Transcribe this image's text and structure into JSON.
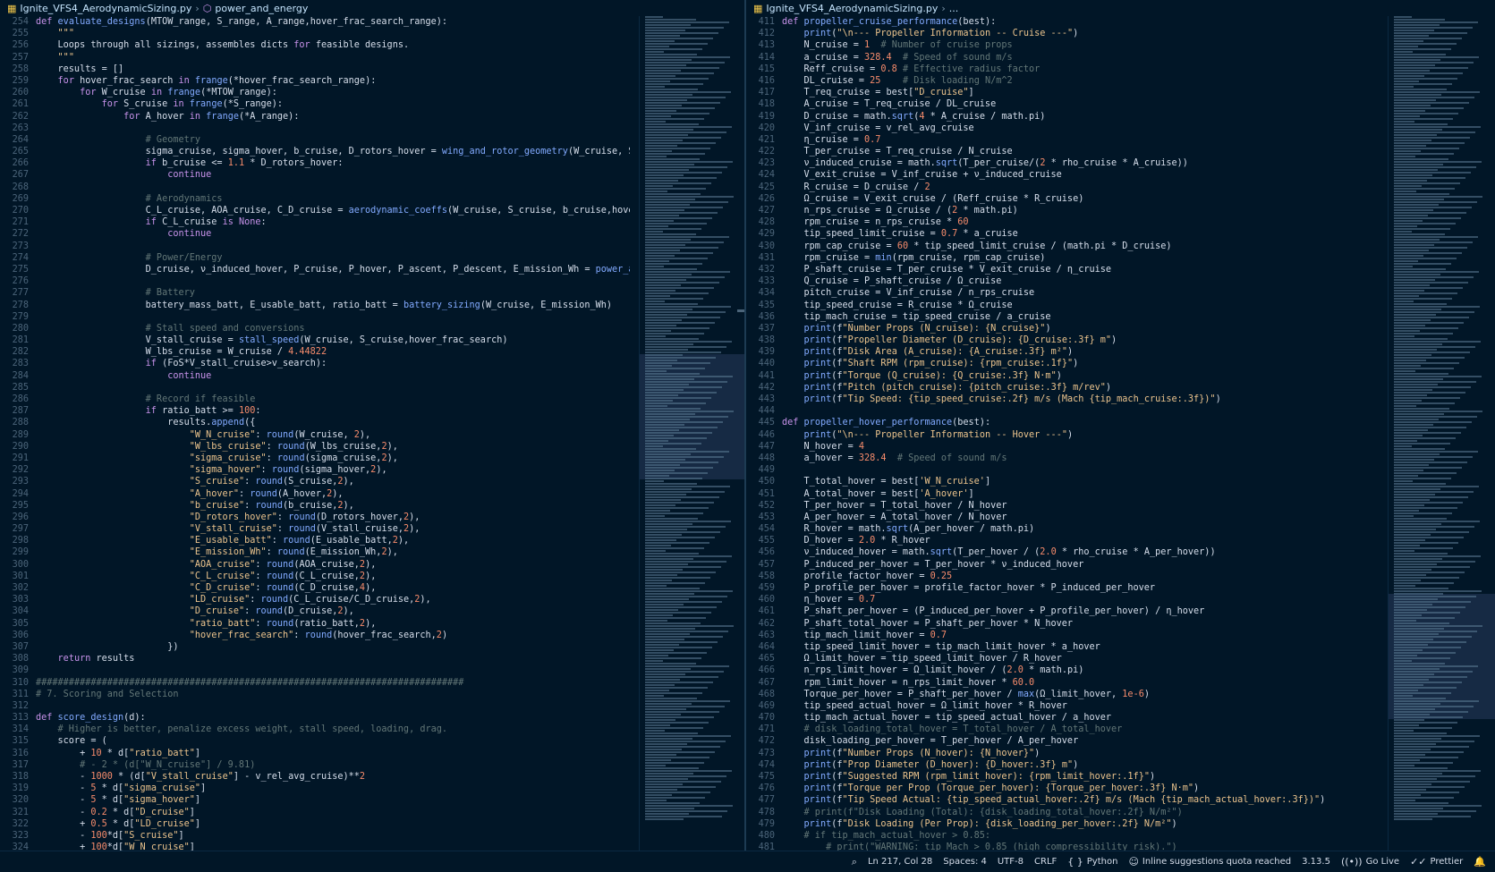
{
  "left_editor": {
    "breadcrumb": {
      "file": "Ignite_VFS4_AerodynamicSizing.py",
      "symbol": "power_and_energy"
    },
    "lines": [
      {
        "n": "254",
        "t": "def evaluate_designs(MTOW_range, S_range, A_range,hover_frac_search_range):"
      },
      {
        "n": "255",
        "t": "    \"\"\""
      },
      {
        "n": "256",
        "t": "    Loops through all sizings, assembles dicts for feasible designs."
      },
      {
        "n": "257",
        "t": "    \"\"\""
      },
      {
        "n": "258",
        "t": "    results = []"
      },
      {
        "n": "259",
        "t": "    for hover_frac_search in frange(*hover_frac_search_range):"
      },
      {
        "n": "260",
        "t": "        for W_cruise in frange(*MTOW_range):"
      },
      {
        "n": "261",
        "t": "            for S_cruise in frange(*S_range):"
      },
      {
        "n": "262",
        "t": "                for A_hover in frange(*A_range):"
      },
      {
        "n": "263",
        "t": ""
      },
      {
        "n": "264",
        "t": "                    # Geometry"
      },
      {
        "n": "265",
        "t": "                    sigma_cruise, sigma_hover, b_cruise, D_rotors_hover = wing_and_rotor_geometry(W_cruise, S_cruise, A_hove"
      },
      {
        "n": "266",
        "t": "                    if b_cruise <= 1.1 * D_rotors_hover:"
      },
      {
        "n": "267",
        "t": "                        continue"
      },
      {
        "n": "268",
        "t": ""
      },
      {
        "n": "269",
        "t": "                    # Aerodynamics"
      },
      {
        "n": "270",
        "t": "                    C_L_cruise, AOA_cruise, C_D_cruise = aerodynamic_coeffs(W_cruise, S_cruise, b_cruise,hover_frac_search)"
      },
      {
        "n": "271",
        "t": "                    if C_L_cruise is None:"
      },
      {
        "n": "272",
        "t": "                        continue"
      },
      {
        "n": "273",
        "t": ""
      },
      {
        "n": "274",
        "t": "                    # Power/Energy"
      },
      {
        "n": "275",
        "t": "                    D_cruise, ν_induced_hover, P_cruise, P_hover, P_ascent, P_descent, E_mission_Wh = power_and_energy(W_cru"
      },
      {
        "n": "276",
        "t": ""
      },
      {
        "n": "277",
        "t": "                    # Battery"
      },
      {
        "n": "278",
        "t": "                    battery_mass_batt, E_usable_batt, ratio_batt = battery_sizing(W_cruise, E_mission_Wh)"
      },
      {
        "n": "279",
        "t": ""
      },
      {
        "n": "280",
        "t": "                    # Stall speed and conversions"
      },
      {
        "n": "281",
        "t": "                    V_stall_cruise = stall_speed(W_cruise, S_cruise,hover_frac_search)"
      },
      {
        "n": "282",
        "t": "                    W_lbs_cruise = W_cruise / 4.44822"
      },
      {
        "n": "283",
        "t": "                    if (FoS*V_stall_cruise>v_search):"
      },
      {
        "n": "284",
        "t": "                        continue"
      },
      {
        "n": "285",
        "t": ""
      },
      {
        "n": "286",
        "t": "                    # Record if feasible"
      },
      {
        "n": "287",
        "t": "                    if ratio_batt >= 100:"
      },
      {
        "n": "288",
        "t": "                        results.append({"
      },
      {
        "n": "289",
        "t": "                            \"W_N_cruise\": round(W_cruise, 2),"
      },
      {
        "n": "290",
        "t": "                            \"W_lbs_cruise\": round(W_lbs_cruise,2),"
      },
      {
        "n": "291",
        "t": "                            \"sigma_cruise\": round(sigma_cruise,2),"
      },
      {
        "n": "292",
        "t": "                            \"sigma_hover\": round(sigma_hover,2),"
      },
      {
        "n": "293",
        "t": "                            \"S_cruise\": round(S_cruise,2),"
      },
      {
        "n": "294",
        "t": "                            \"A_hover\": round(A_hover,2),"
      },
      {
        "n": "295",
        "t": "                            \"b_cruise\": round(b_cruise,2),"
      },
      {
        "n": "296",
        "t": "                            \"D_rotors_hover\": round(D_rotors_hover,2),"
      },
      {
        "n": "297",
        "t": "                            \"V_stall_cruise\": round(V_stall_cruise,2),"
      },
      {
        "n": "298",
        "t": "                            \"E_usable_batt\": round(E_usable_batt,2),"
      },
      {
        "n": "299",
        "t": "                            \"E_mission_Wh\": round(E_mission_Wh,2),"
      },
      {
        "n": "300",
        "t": "                            \"AOA_cruise\": round(AOA_cruise,2),"
      },
      {
        "n": "301",
        "t": "                            \"C_L_cruise\": round(C_L_cruise,2),"
      },
      {
        "n": "302",
        "t": "                            \"C_D_cruise\": round(C_D_cruise,4),"
      },
      {
        "n": "303",
        "t": "                            \"LD_cruise\": round(C_L_cruise/C_D_cruise,2),"
      },
      {
        "n": "304",
        "t": "                            \"D_cruise\": round(D_cruise,2),"
      },
      {
        "n": "305",
        "t": "                            \"ratio_batt\": round(ratio_batt,2),"
      },
      {
        "n": "306",
        "t": "                            \"hover_frac_search\": round(hover_frac_search,2)"
      },
      {
        "n": "307",
        "t": "                        })"
      },
      {
        "n": "308",
        "t": "    return results"
      },
      {
        "n": "309",
        "t": ""
      },
      {
        "n": "310",
        "t": "##############################################################################"
      },
      {
        "n": "311",
        "t": "# 7. Scoring and Selection"
      },
      {
        "n": "312",
        "t": ""
      },
      {
        "n": "313",
        "t": "def score_design(d):"
      },
      {
        "n": "314",
        "t": "    # Higher is better, penalize excess weight, stall speed, loading, drag."
      },
      {
        "n": "315",
        "t": "    score = ("
      },
      {
        "n": "316",
        "t": "        + 10 * d[\"ratio_batt\"]"
      },
      {
        "n": "317",
        "t": "        # - 2 * (d[\"W_N_cruise\"] / 9.81)"
      },
      {
        "n": "318",
        "t": "        - 1000 * (d[\"V_stall_cruise\"] - v_rel_avg_cruise)**2"
      },
      {
        "n": "319",
        "t": "        - 5 * d[\"sigma_cruise\"]"
      },
      {
        "n": "320",
        "t": "        - 5 * d[\"sigma_hover\"]"
      },
      {
        "n": "321",
        "t": "        - 0.2 * d[\"D_cruise\"]"
      },
      {
        "n": "322",
        "t": "        + 0.5 * d[\"LD_cruise\"]"
      },
      {
        "n": "323",
        "t": "        - 100*d[\"S_cruise\"]"
      },
      {
        "n": "324",
        "t": "        + 100*d[\"W_N_cruise\"]"
      }
    ]
  },
  "right_editor": {
    "breadcrumb": {
      "file": "Ignite_VFS4_AerodynamicSizing.py",
      "symbol": "..."
    },
    "lines": [
      {
        "n": "411",
        "t": "def propeller_cruise_performance(best):"
      },
      {
        "n": "412",
        "t": "    print(\"\\n--- Propeller Information -- Cruise ---\")"
      },
      {
        "n": "413",
        "t": "    N_cruise = 1  # Number of cruise props"
      },
      {
        "n": "414",
        "t": "    a_cruise = 328.4  # Speed of sound m/s"
      },
      {
        "n": "415",
        "t": "    Reff_cruise = 0.8 # Effective radius factor"
      },
      {
        "n": "416",
        "t": "    DL_cruise = 25    # Disk loading N/m^2"
      },
      {
        "n": "417",
        "t": "    T_req_cruise = best[\"D_cruise\"]"
      },
      {
        "n": "418",
        "t": "    A_cruise = T_req_cruise / DL_cruise"
      },
      {
        "n": "419",
        "t": "    D_cruise = math.sqrt(4 * A_cruise / math.pi)"
      },
      {
        "n": "420",
        "t": "    V_inf_cruise = v_rel_avg_cruise"
      },
      {
        "n": "421",
        "t": "    η_cruise = 0.7"
      },
      {
        "n": "422",
        "t": "    T_per_cruise = T_req_cruise / N_cruise"
      },
      {
        "n": "423",
        "t": "    ν_induced_cruise = math.sqrt(T_per_cruise/(2 * rho_cruise * A_cruise))"
      },
      {
        "n": "424",
        "t": "    V_exit_cruise = V_inf_cruise + ν_induced_cruise"
      },
      {
        "n": "425",
        "t": "    R_cruise = D_cruise / 2"
      },
      {
        "n": "426",
        "t": "    Ω_cruise = V_exit_cruise / (Reff_cruise * R_cruise)"
      },
      {
        "n": "427",
        "t": "    n_rps_cruise = Ω_cruise / (2 * math.pi)"
      },
      {
        "n": "428",
        "t": "    rpm_cruise = n_rps_cruise * 60"
      },
      {
        "n": "429",
        "t": "    tip_speed_limit_cruise = 0.7 * a_cruise"
      },
      {
        "n": "430",
        "t": "    rpm_cap_cruise = 60 * tip_speed_limit_cruise / (math.pi * D_cruise)"
      },
      {
        "n": "431",
        "t": "    rpm_cruise = min(rpm_cruise, rpm_cap_cruise)"
      },
      {
        "n": "432",
        "t": "    P_shaft_cruise = T_per_cruise * V_exit_cruise / η_cruise"
      },
      {
        "n": "433",
        "t": "    Q_cruise = P_shaft_cruise / Ω_cruise"
      },
      {
        "n": "434",
        "t": "    pitch_cruise = V_inf_cruise / n_rps_cruise"
      },
      {
        "n": "435",
        "t": "    tip_speed_cruise = R_cruise * Ω_cruise"
      },
      {
        "n": "436",
        "t": "    tip_mach_cruise = tip_speed_cruise / a_cruise"
      },
      {
        "n": "437",
        "t": "    print(f\"Number Props (N_cruise): {N_cruise}\")"
      },
      {
        "n": "438",
        "t": "    print(f\"Propeller Diameter (D_cruise): {D_cruise:.3f} m\")"
      },
      {
        "n": "439",
        "t": "    print(f\"Disk Area (A_cruise): {A_cruise:.3f} m²\")"
      },
      {
        "n": "440",
        "t": "    print(f\"Shaft RPM (rpm_cruise): {rpm_cruise:.1f}\")"
      },
      {
        "n": "441",
        "t": "    print(f\"Torque (Q_cruise): {Q_cruise:.3f} N·m\")"
      },
      {
        "n": "442",
        "t": "    print(f\"Pitch (pitch_cruise): {pitch_cruise:.3f} m/rev\")"
      },
      {
        "n": "443",
        "t": "    print(f\"Tip Speed: {tip_speed_cruise:.2f} m/s (Mach {tip_mach_cruise:.3f})\")"
      },
      {
        "n": "444",
        "t": ""
      },
      {
        "n": "445",
        "t": "def propeller_hover_performance(best):"
      },
      {
        "n": "446",
        "t": "    print(\"\\n--- Propeller Information -- Hover ---\")"
      },
      {
        "n": "447",
        "t": "    N_hover = 4"
      },
      {
        "n": "448",
        "t": "    a_hover = 328.4  # Speed of sound m/s"
      },
      {
        "n": "449",
        "t": ""
      },
      {
        "n": "450",
        "t": "    T_total_hover = best['W_N_cruise']"
      },
      {
        "n": "451",
        "t": "    A_total_hover = best['A_hover']"
      },
      {
        "n": "452",
        "t": "    T_per_hover = T_total_hover / N_hover"
      },
      {
        "n": "453",
        "t": "    A_per_hover = A_total_hover / N_hover"
      },
      {
        "n": "454",
        "t": "    R_hover = math.sqrt(A_per_hover / math.pi)"
      },
      {
        "n": "455",
        "t": "    D_hover = 2.0 * R_hover"
      },
      {
        "n": "456",
        "t": "    ν_induced_hover = math.sqrt(T_per_hover / (2.0 * rho_cruise * A_per_hover))"
      },
      {
        "n": "457",
        "t": "    P_induced_per_hover = T_per_hover * ν_induced_hover"
      },
      {
        "n": "458",
        "t": "    profile_factor_hover = 0.25"
      },
      {
        "n": "459",
        "t": "    P_profile_per_hover = profile_factor_hover * P_induced_per_hover"
      },
      {
        "n": "460",
        "t": "    η_hover = 0.7"
      },
      {
        "n": "461",
        "t": "    P_shaft_per_hover = (P_induced_per_hover + P_profile_per_hover) / η_hover"
      },
      {
        "n": "462",
        "t": "    P_shaft_total_hover = P_shaft_per_hover * N_hover"
      },
      {
        "n": "463",
        "t": "    tip_mach_limit_hover = 0.7"
      },
      {
        "n": "464",
        "t": "    tip_speed_limit_hover = tip_mach_limit_hover * a_hover"
      },
      {
        "n": "465",
        "t": "    Ω_limit_hover = tip_speed_limit_hover / R_hover"
      },
      {
        "n": "466",
        "t": "    n_rps_limit_hover = Ω_limit_hover / (2.0 * math.pi)"
      },
      {
        "n": "467",
        "t": "    rpm_limit_hover = n_rps_limit_hover * 60.0"
      },
      {
        "n": "468",
        "t": "    Torque_per_hover = P_shaft_per_hover / max(Ω_limit_hover, 1e-6)"
      },
      {
        "n": "469",
        "t": "    tip_speed_actual_hover = Ω_limit_hover * R_hover"
      },
      {
        "n": "470",
        "t": "    tip_mach_actual_hover = tip_speed_actual_hover / a_hover"
      },
      {
        "n": "471",
        "t": "    # disk_loading_total_hover = T_total_hover / A_total_hover"
      },
      {
        "n": "472",
        "t": "    disk_loading_per_hover = T_per_hover / A_per_hover"
      },
      {
        "n": "473",
        "t": "    print(f\"Number Props (N_hover): {N_hover}\")"
      },
      {
        "n": "474",
        "t": "    print(f\"Prop Diameter (D_hover): {D_hover:.3f} m\")"
      },
      {
        "n": "475",
        "t": "    print(f\"Suggested RPM (rpm_limit_hover): {rpm_limit_hover:.1f}\")"
      },
      {
        "n": "476",
        "t": "    print(f\"Torque per Prop (Torque_per_hover): {Torque_per_hover:.3f} N·m\")"
      },
      {
        "n": "477",
        "t": "    print(f\"Tip Speed Actual: {tip_speed_actual_hover:.2f} m/s (Mach {tip_mach_actual_hover:.3f})\")"
      },
      {
        "n": "478",
        "t": "    # print(f\"Disk Loading (Total): {disk_loading_total_hover:.2f} N/m²\")"
      },
      {
        "n": "479",
        "t": "    print(f\"Disk Loading (Per Prop): {disk_loading_per_hover:.2f} N/m²\")"
      },
      {
        "n": "480",
        "t": "    # if tip_mach_actual_hover > 0.85:"
      },
      {
        "n": "481",
        "t": "        # print(\"WARNING: tip Mach > 0.85 (high compressibility risk).\")"
      }
    ]
  },
  "status_bar": {
    "cursor": "Ln 217, Col 28",
    "spaces": "Spaces: 4",
    "encoding": "UTF-8",
    "eol": "CRLF",
    "language": "Python",
    "inline_suggestions": "Inline suggestions quota reached",
    "version": "3.13.5",
    "go_live": "Go Live",
    "prettier": "Prettier"
  },
  "colors": {
    "background": "#011627",
    "keyword": "#c792ea",
    "function": "#82aaff",
    "string": "#ecc48d",
    "number": "#f78c6c",
    "comment": "#637777",
    "variable": "#d6deeb"
  },
  "icons": [
    "python-file-icon",
    "symbol-icon",
    "search-icon",
    "braces-icon",
    "copilot-icon",
    "broadcast-icon",
    "check-icon",
    "bell-icon"
  ]
}
